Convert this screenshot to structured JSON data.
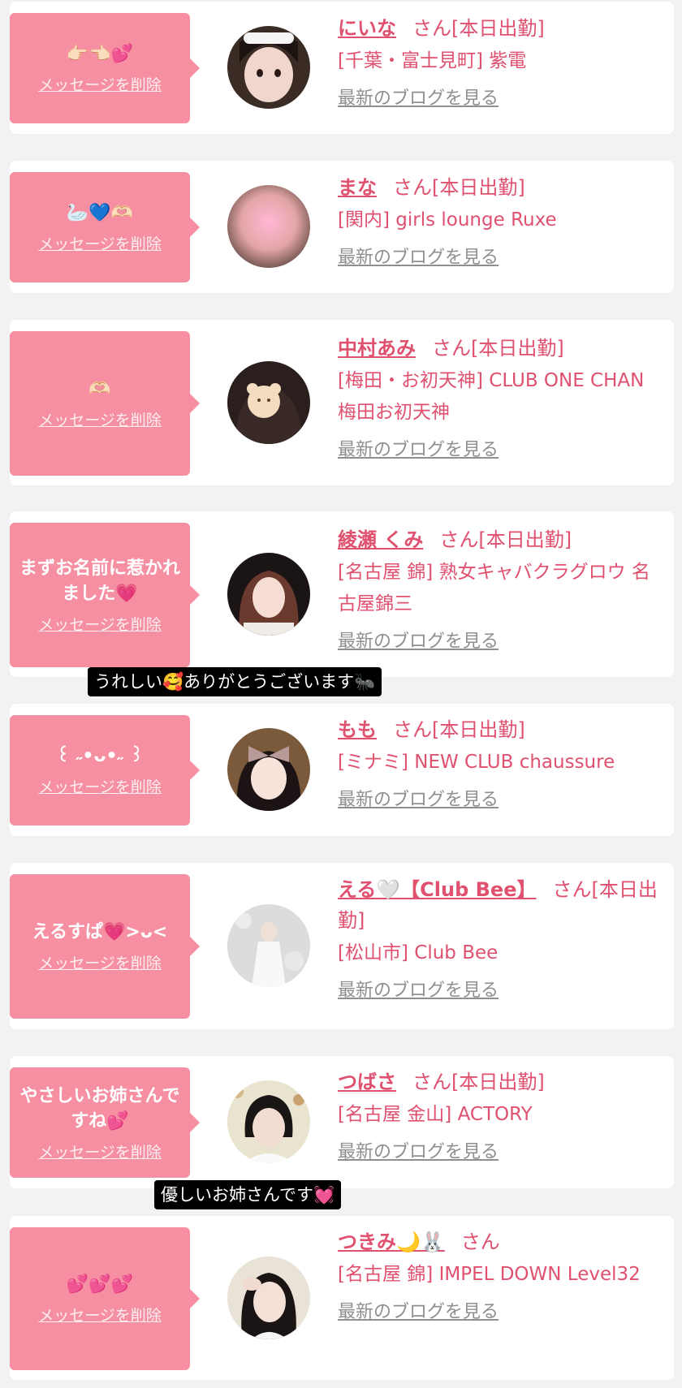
{
  "common": {
    "delete_label": "メッセージを削除",
    "blog_label": "最新のブログを見る"
  },
  "items": [
    {
      "message": "👉🏻👈🏻💕",
      "name": "にいな",
      "suffix": "さん[本日出勤]",
      "shop": "[千葉・富士見町] 紫電",
      "avatar_icon": "girl-photo"
    },
    {
      "message": "🦢💙🫶🏻",
      "name": "まな",
      "suffix": "さん[本日出勤]",
      "shop": "[関内] girls lounge Ruxe",
      "avatar_icon": "blurred-photo"
    },
    {
      "message": "🫶🏻",
      "name": "中村あみ",
      "suffix": "さん[本日出勤]",
      "shop": "[梅田・お初天神] CLUB ONE CHAN 梅田お初天神",
      "avatar_icon": "bear-sticker-photo"
    },
    {
      "message": "まずお名前に惹かれました💗",
      "name": "綾瀬 くみ",
      "suffix": "さん[本日出勤]",
      "shop": "[名古屋 錦] 熟女キャバクラグロウ 名古屋錦三",
      "avatar_icon": "woman-photo"
    },
    {
      "message": "꒰ ˶•ᴗ•˶ ꒱",
      "name": "もも",
      "suffix": "さん[本日出勤]",
      "shop": "[ミナミ] NEW CLUB chaussure",
      "avatar_icon": "bow-girl-photo"
    },
    {
      "message": "えるすぱ💗>ᴗ<",
      "name": "える🤍【Club Bee】",
      "suffix": "さん[本日出勤]",
      "shop": "[松山市] Club Bee",
      "avatar_icon": "white-dress-photo"
    },
    {
      "message": "やさしいお姉さんですね💕",
      "name": "つばさ",
      "suffix": "さん[本日出勤]",
      "shop": "[名古屋 金山] ACTORY",
      "avatar_icon": "short-hair-photo"
    },
    {
      "message": "💕💕💕",
      "name": "つきみ🌙🐰",
      "suffix": "さん",
      "shop": "[名古屋 錦] IMPEL DOWN Level32",
      "avatar_icon": "salute-girl-photo"
    }
  ],
  "captions": [
    "うれしい🥰ありがとうございます🐜",
    "優しいお姉さんです💓"
  ],
  "colors": {
    "bubble": "#f58fa1",
    "name": "#e0506f",
    "link_gray": "#8f8f8f",
    "background": "#f2f2f2"
  }
}
